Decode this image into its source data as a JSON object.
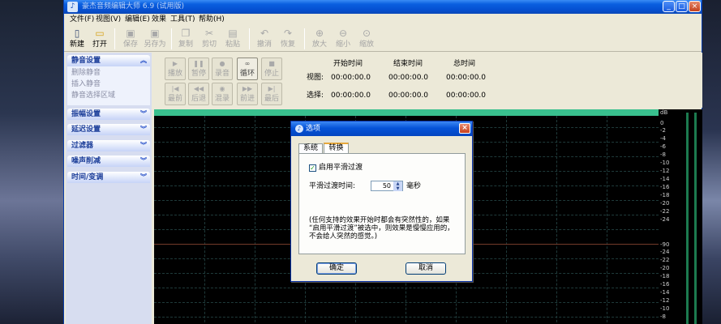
{
  "window": {
    "title": "豪杰音频编辑大师 6.9 (试用版)",
    "min": "_",
    "max": "□",
    "close": "×"
  },
  "menu": [
    "文件(F)",
    "视图(V)",
    "编辑(E)",
    "效果",
    "工具(T)",
    "帮助(H)"
  ],
  "toolbar": [
    {
      "label": "新建",
      "icon": "new-file-icon",
      "glyph": "▯",
      "enabled": true
    },
    {
      "label": "打开",
      "icon": "open-folder-icon",
      "glyph": "▭",
      "enabled": true
    },
    {
      "label": "保存",
      "icon": "save-icon",
      "glyph": "▣",
      "enabled": false
    },
    {
      "label": "另存为",
      "icon": "save-as-icon",
      "glyph": "▣",
      "enabled": false
    },
    {
      "label": "复制",
      "icon": "copy-icon",
      "glyph": "❐",
      "enabled": false
    },
    {
      "label": "剪切",
      "icon": "cut-icon",
      "glyph": "✂",
      "enabled": false
    },
    {
      "label": "粘贴",
      "icon": "paste-icon",
      "glyph": "▤",
      "enabled": false
    },
    {
      "label": "撤消",
      "icon": "undo-icon",
      "glyph": "↶",
      "enabled": false
    },
    {
      "label": "恢复",
      "icon": "redo-icon",
      "glyph": "↷",
      "enabled": false
    },
    {
      "label": "放大",
      "icon": "zoom-in-icon",
      "glyph": "⊕",
      "enabled": false
    },
    {
      "label": "缩小",
      "icon": "zoom-out-icon",
      "glyph": "⊖",
      "enabled": false
    },
    {
      "label": "缩放",
      "icon": "zoom-icon",
      "glyph": "⊙",
      "enabled": false
    }
  ],
  "sidebar": {
    "sections": [
      {
        "label": "静音设置",
        "chevron": "︽",
        "items": [
          "删除静音",
          "插入静音",
          "静音选择区域"
        ]
      },
      {
        "label": "振幅设置",
        "chevron": "︾"
      },
      {
        "label": "延迟设置",
        "chevron": "︾"
      },
      {
        "label": "过滤器",
        "chevron": "︾"
      },
      {
        "label": "噪声削减",
        "chevron": "︾"
      },
      {
        "label": "时间/变调",
        "chevron": "︾"
      }
    ]
  },
  "transport": {
    "row1": [
      {
        "label": "播放",
        "icon": "play-icon",
        "glyph": "▶",
        "active": false
      },
      {
        "label": "暂停",
        "icon": "pause-icon",
        "glyph": "❚❚",
        "active": false
      },
      {
        "label": "录音",
        "icon": "record-icon",
        "glyph": "●",
        "active": false
      },
      {
        "label": "循环",
        "icon": "loop-icon",
        "glyph": "∞",
        "active": true
      },
      {
        "label": "停止",
        "icon": "stop-icon",
        "glyph": "■",
        "active": false
      }
    ],
    "row2": [
      {
        "label": "最前",
        "icon": "to-start-icon",
        "glyph": "|◀",
        "active": false
      },
      {
        "label": "后退",
        "icon": "rewind-icon",
        "glyph": "◀◀",
        "active": false
      },
      {
        "label": "混录",
        "icon": "mix-record-icon",
        "glyph": "◉",
        "active": false
      },
      {
        "label": "前进",
        "icon": "forward-icon",
        "glyph": "▶▶",
        "active": false
      },
      {
        "label": "最后",
        "icon": "to-end-icon",
        "glyph": "▶|",
        "active": false
      }
    ]
  },
  "time": {
    "headers": [
      "开始时间",
      "结束时间",
      "总时间"
    ],
    "view_label": "视图:",
    "select_label": "选择:",
    "view": [
      "00:00:00.0",
      "00:00:00.0",
      "00:00:00.0"
    ],
    "select": [
      "00:00:00.0",
      "00:00:00.0",
      "00:00:00.0"
    ]
  },
  "ruler": [
    "dB",
    "0",
    "-2",
    "-4",
    "-6",
    "-8",
    "-10",
    "-12",
    "-14",
    "-16",
    "-18",
    "-20",
    "-22",
    "-24",
    "-90",
    "-24",
    "-22",
    "-20",
    "-18",
    "-16",
    "-14",
    "-12",
    "-10",
    "-8"
  ],
  "dialog": {
    "title": "选项",
    "tabs": [
      "系统",
      "转换"
    ],
    "smooth_checkbox": "启用平滑过渡",
    "smooth_checked": true,
    "smooth_time_label": "平滑过渡时间:",
    "smooth_time_value": "50",
    "unit": "毫秒",
    "note": "(任何支持的效果开始时都会有突然性的，如果\n“启用平滑过渡”被选中，则效果是慢慢应用的，\n不会给人突然的感觉。)",
    "ok": "确定",
    "cancel": "取消"
  },
  "colors": {
    "title_blue": "#0550d2",
    "wave_bg": "#000000",
    "wave_top": "#39c08e",
    "panel_head": "#1d3f9a"
  }
}
